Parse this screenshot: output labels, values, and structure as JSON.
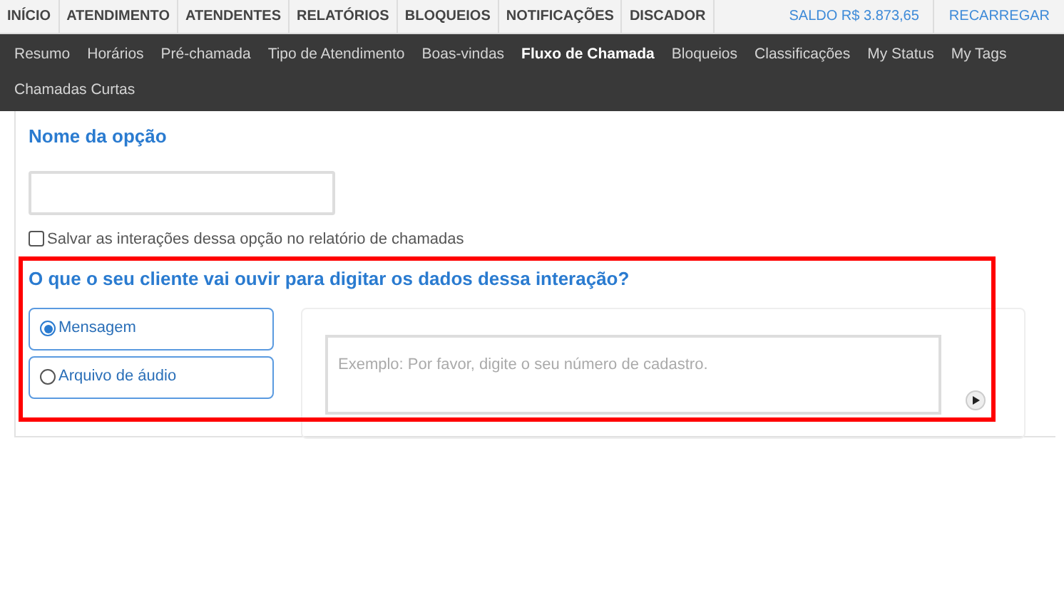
{
  "top_nav": {
    "items": [
      {
        "label": "INÍCIO",
        "selected": false
      },
      {
        "label": "ATENDIMENTO",
        "selected": false
      },
      {
        "label": "ATENDENTES",
        "selected": false
      },
      {
        "label": "RELATÓRIOS",
        "selected": false
      },
      {
        "label": "BLOQUEIOS",
        "selected": false
      },
      {
        "label": "NOTIFICAÇÕES",
        "selected": false
      },
      {
        "label": "DISCADOR",
        "selected": false
      }
    ],
    "balance": "SALDO R$ 3.873,65",
    "recharge": "RECARREGAR"
  },
  "sub_nav": {
    "items": [
      {
        "label": "Resumo",
        "selected": false
      },
      {
        "label": "Horários",
        "selected": false
      },
      {
        "label": "Pré-chamada",
        "selected": false
      },
      {
        "label": "Tipo de Atendimento",
        "selected": false
      },
      {
        "label": "Boas-vindas",
        "selected": false
      },
      {
        "label": "Fluxo de Chamada",
        "selected": true
      },
      {
        "label": "Bloqueios",
        "selected": false
      },
      {
        "label": "Classificações",
        "selected": false
      },
      {
        "label": "My Status",
        "selected": false
      },
      {
        "label": "My Tags",
        "selected": false
      },
      {
        "label": "Chamadas Curtas",
        "selected": false
      }
    ]
  },
  "form": {
    "option_name_label": "Nome da opção",
    "save_checkbox": {
      "label": "Salvar as interações dessa opção no relatório de chamadas",
      "checked": false
    },
    "question": "O que o seu cliente vai ouvir para digitar os dados dessa interação?",
    "choices": [
      {
        "label": "Mensagem",
        "selected": true
      },
      {
        "label": "Arquivo de áudio",
        "selected": false
      }
    ],
    "message": {
      "placeholder": "Exemplo: Por favor, digite o seu número de cadastro."
    }
  }
}
